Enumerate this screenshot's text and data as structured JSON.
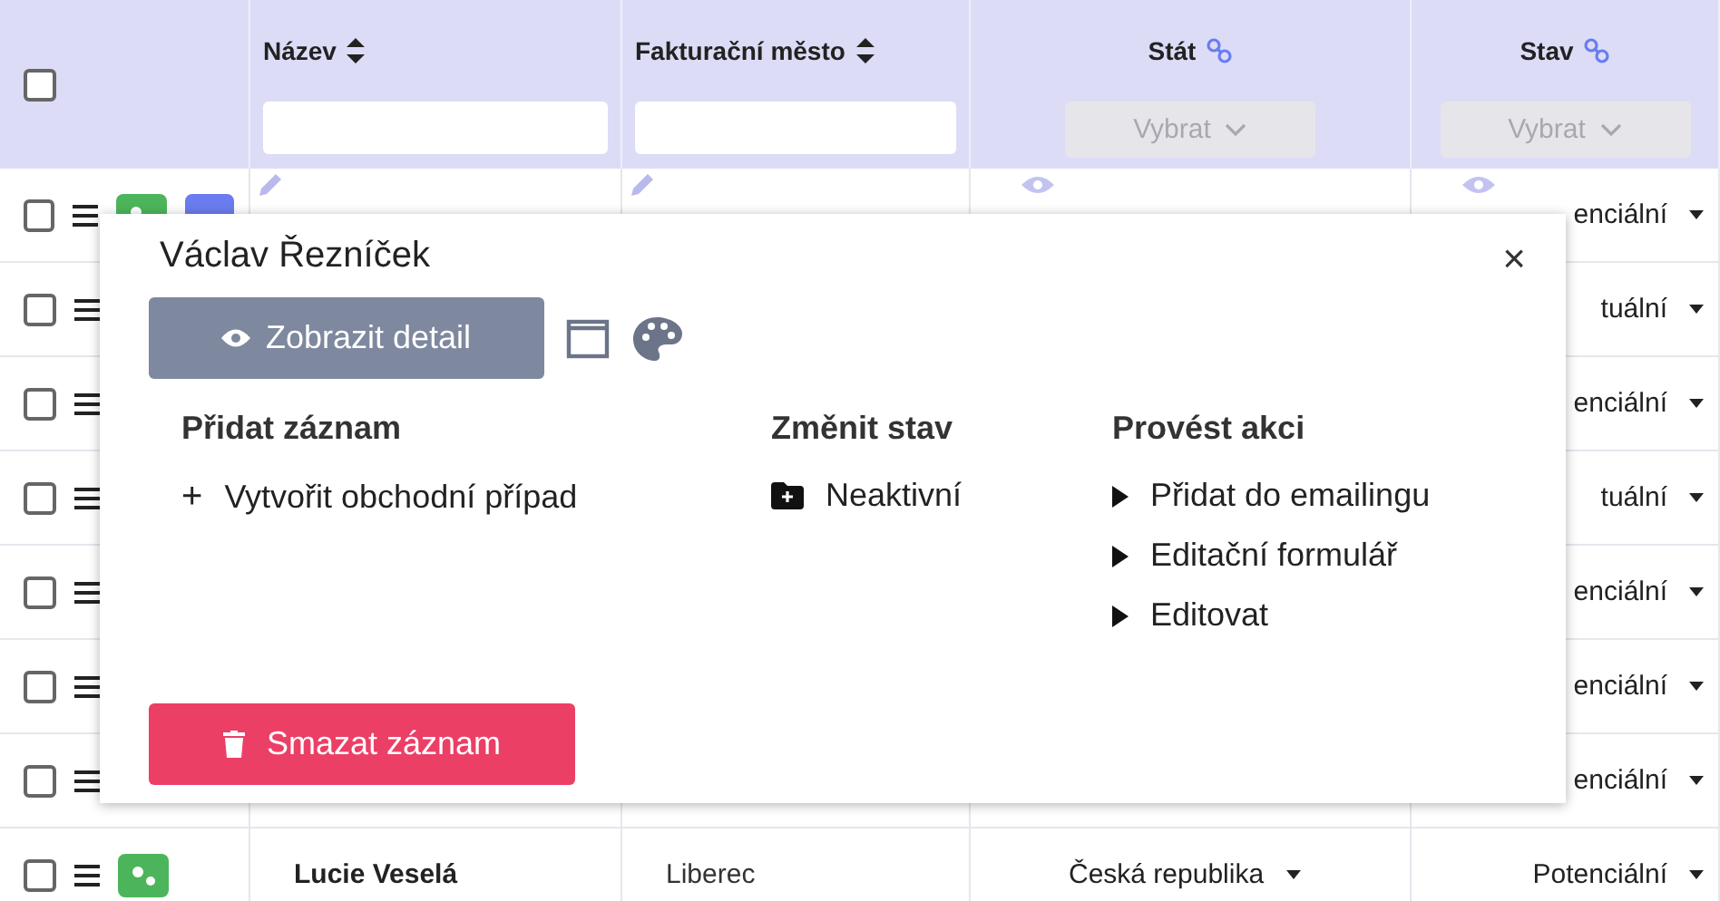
{
  "table": {
    "select_all": {
      "checked": false
    },
    "columns": [
      {
        "label": "Název",
        "kind": "sortable"
      },
      {
        "label": "Fakturační město",
        "kind": "sortable"
      },
      {
        "label": "Stát",
        "kind": "linked",
        "placeholder": "Vybrat"
      },
      {
        "label": "Stav",
        "kind": "linked",
        "placeholder": "Vybrat"
      }
    ],
    "rows": [
      {
        "kind": "hovered",
        "checked": false,
        "stav": "enciální"
      },
      {
        "kind": "plain",
        "checked": false,
        "stav": "tuální"
      },
      {
        "kind": "plain",
        "checked": false,
        "stav": "enciální"
      },
      {
        "kind": "plain",
        "checked": false,
        "stav": "tuální"
      },
      {
        "kind": "plain",
        "checked": false,
        "stav": "enciální"
      },
      {
        "kind": "plain",
        "checked": false,
        "stav": "enciální"
      },
      {
        "kind": "plain",
        "checked": false,
        "stav": "enciální"
      },
      {
        "kind": "plain",
        "checked": false,
        "name": "Lucie Veselá",
        "city": "Liberec",
        "stat": "Česká republika",
        "stav": "Potenciální"
      }
    ]
  },
  "popup": {
    "title": "Václav Řezníček",
    "close": "×",
    "detail_button": "Zobrazit detail",
    "sections": [
      {
        "heading": "Přidat záznam",
        "items": [
          {
            "kind": "add",
            "icon": "+",
            "label": "Vytvořit obchodní případ"
          }
        ]
      },
      {
        "heading": "Změnit stav",
        "items": [
          {
            "kind": "folder",
            "label": "Neaktivní"
          }
        ]
      },
      {
        "heading": "Provést akci",
        "items": [
          {
            "kind": "action",
            "label": "Přidat do emailingu"
          },
          {
            "kind": "action",
            "label": "Editační formulář"
          },
          {
            "kind": "action",
            "label": "Editovat"
          }
        ]
      }
    ],
    "delete_button": "Smazat záznam"
  }
}
